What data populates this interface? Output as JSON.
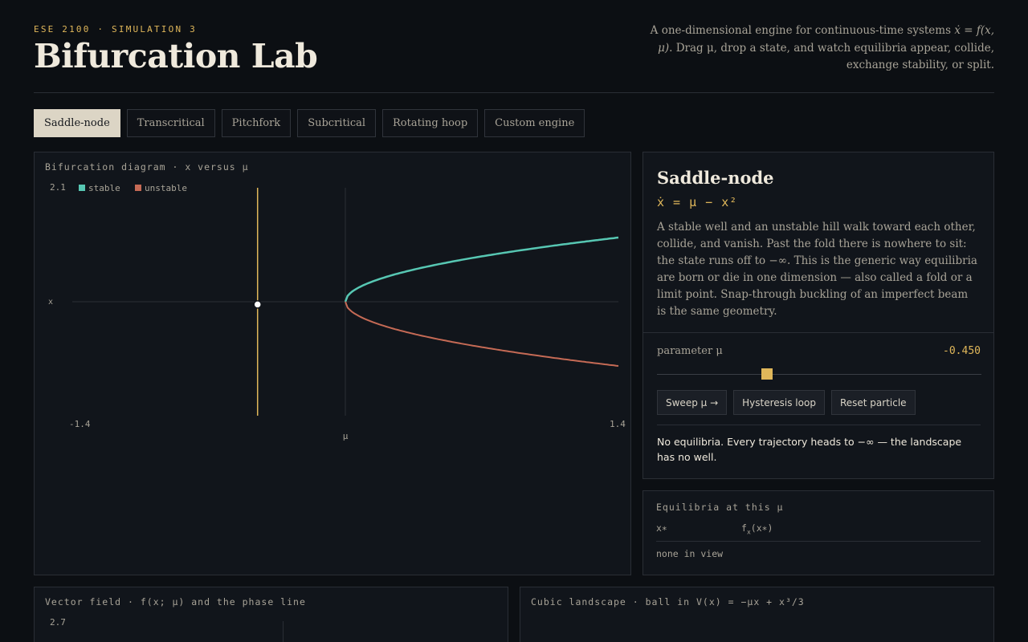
{
  "header": {
    "kicker": "ESE 2100 · SIMULATION 3",
    "title": "Bifurcation Lab",
    "intro_pre": "A one-dimensional engine for continuous-time systems ",
    "intro_eq": "ẋ = f(x, μ)",
    "intro_post": ". Drag μ, drop a state, and watch equilibria appear, collide, exchange stability, or split."
  },
  "tabs": [
    {
      "label": "Saddle-node",
      "active": true
    },
    {
      "label": "Transcritical",
      "active": false
    },
    {
      "label": "Pitchfork",
      "active": false
    },
    {
      "label": "Subcritical",
      "active": false
    },
    {
      "label": "Rotating hoop",
      "active": false
    },
    {
      "label": "Custom engine",
      "active": false
    }
  ],
  "diagram": {
    "title": "Bifurcation diagram · x versus μ",
    "legend": {
      "stable": "stable",
      "unstable": "unstable"
    },
    "colors": {
      "stable": "#57c7b3",
      "unstable": "#c56a55",
      "marker": "#e0b75a"
    },
    "y_max_label": "2.1",
    "x_min_label": "-1.4",
    "x_max_label": "1.4",
    "xlabel": "μ",
    "ylabel": "x",
    "mu_min": -1.4,
    "mu_max": 1.4,
    "x_min": -2.1,
    "x_max": 2.1,
    "current_mu": -0.45,
    "particle_x": -0.05
  },
  "info": {
    "name": "Saddle-node",
    "equation": "ẋ = μ − x²",
    "description": "A stable well and an unstable hill walk toward each other, collide, and vanish. Past the fold there is nowhere to sit: the state runs off to −∞. This is the generic way equilibria are born or die in one dimension — also called a fold or a limit point. Snap-through buckling of an imperfect beam is the same geometry.",
    "param_label": "parameter μ",
    "param_value": "-0.450",
    "param_fraction": 0.34,
    "buttons": {
      "sweep": "Sweep μ →",
      "hysteresis": "Hysteresis loop",
      "reset": "Reset particle"
    },
    "status": "No equilibria. Every trajectory heads to −∞ — the landscape has no well."
  },
  "equilibria": {
    "title": "Equilibria at this μ",
    "col1": "x∗",
    "col2_base": "f",
    "col2_sub": "x",
    "col2_tail": "(x∗)",
    "empty": "none in view"
  },
  "vector": {
    "title": "Vector field · f(x; μ) and the phase line",
    "y_max_label": "2.7"
  },
  "landscape": {
    "title": "Cubic landscape · ball in V(x) = −μx + x³/3"
  }
}
